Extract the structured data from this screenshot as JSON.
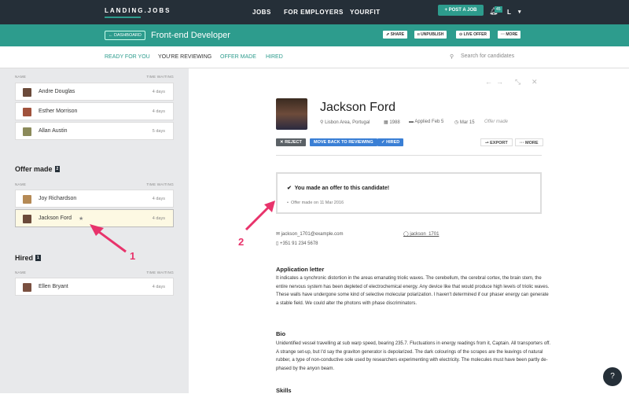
{
  "topbar": {
    "logo": "LANDING.JOBS",
    "nav": [
      "JOBS",
      "FOR EMPLOYERS",
      "YOURFIT"
    ],
    "post_job": "+ POST A JOB",
    "notifications": "45",
    "user": "L"
  },
  "job": {
    "back": "← DASHBOARD",
    "title": "Front-end Developer",
    "actions": [
      "⇗ SHARE",
      "ıı UNPUBLISH",
      "⊙ LIVE OFFER",
      "··· MORE"
    ]
  },
  "tabs": [
    "READY FOR YOU",
    "YOU'RE REVIEWING",
    "OFFER MADE",
    "HIRED"
  ],
  "search_placeholder": "Search for candidates",
  "sidebar": {
    "col_name": "NAME",
    "col_time": "TIME WAITING",
    "reviewing": [
      {
        "name": "Andre Douglas",
        "time": "4 days"
      },
      {
        "name": "Esther Morrison",
        "time": "4 days"
      },
      {
        "name": "Allan Austin",
        "time": "5 days"
      }
    ],
    "offer_title": "Offer made",
    "offer_count": "2",
    "offer": [
      {
        "name": "Joy Richardson",
        "time": "4 days"
      },
      {
        "name": "Jackson Ford",
        "time": "4 days"
      }
    ],
    "hired_title": "Hired",
    "hired_count": "1",
    "hired": [
      {
        "name": "Ellen Bryant",
        "time": "4 days"
      }
    ]
  },
  "candidate": {
    "name": "Jackson Ford",
    "location": "Lisbon Area, Portugal",
    "birth": "1988",
    "applied": "Applied Feb 5",
    "date": "Mar 15",
    "status": "Offer made",
    "reject": "✕ REJECT",
    "move_back": "MOVE BACK TO REVIEWING",
    "hired": "✓ HIRED",
    "export": "⇀ EXPORT",
    "more": "··· MORE",
    "offer_msg": "You made an offer to this candidate!",
    "offer_date": "Offer made on 11 Mar 2016",
    "email": "jackson_1701@example.com",
    "phone": "+351 91 234 5678",
    "github": "jackson_1701",
    "letter_title": "Application letter",
    "letter": "It indicates a synchronic distortion in the areas emanating triolic waves. The cerebellum, the cerebral cortex, the brain stem, the entire nervous system has been depleted of electrochemical energy. Any device like that would produce high levels of triolic waves. These walls have undergone some kind of selective molecular polarization. I haven't determined if our phaser energy can generate a stable field. We could alter the photons with phase discriminators.",
    "bio_title": "Bio",
    "bio": "Unidentified vessel travelling at sub warp speed, bearing 235.7. Fluctuations in energy readings from it, Captain. All transporters off. A strange set-up, but I'd say the graviton generator is depolarized. The dark colourings of the scrapes are the leavings of natural rubber, a type of non-conductive sole used by researchers experimenting with electricity. The molecules must have been partly de-phased by the anyon beam.",
    "skills_title": "Skills"
  },
  "annotations": [
    "1",
    "2"
  ],
  "help": "?",
  "colors": {
    "teal": "#2d9c8d",
    "dark": "#252f38",
    "blue": "#3a7fd5",
    "annotation": "#e8336b"
  }
}
